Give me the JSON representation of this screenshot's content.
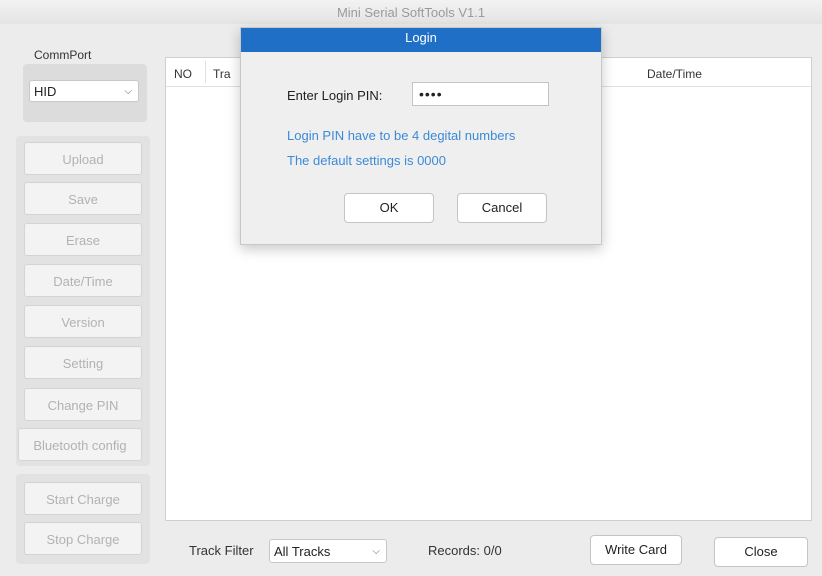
{
  "window": {
    "title": "Mini Serial SoftTools V1.1"
  },
  "sidebar": {
    "commport_label": "CommPort",
    "commport_value": "HID",
    "buttons": [
      "Upload",
      "Save",
      "Erase",
      "Date/Time",
      "Version",
      "Setting",
      "Change PIN",
      "Bluetooth config"
    ],
    "charge_buttons": [
      "Start Charge",
      "Stop Charge"
    ]
  },
  "table": {
    "columns": {
      "no": "NO",
      "track": "Tra",
      "datetime": "Date/Time"
    }
  },
  "bottom": {
    "track_filter_label": "Track Filter",
    "track_filter_value": "All Tracks",
    "records": "Records: 0/0",
    "write_card": "Write Card",
    "close": "Close"
  },
  "dialog": {
    "title": "Login",
    "pin_label": "Enter Login PIN:",
    "pin_value": "••••",
    "hint1": "Login PIN have to be 4 degital numbers",
    "hint2": "The default settings is 0000",
    "ok": "OK",
    "cancel": "Cancel"
  },
  "colors": {
    "dialog_title_bg": "#1f6fc6",
    "hint_text": "#3b8ad8"
  },
  "icons": {
    "dropdown": "chevron-down-icon"
  }
}
